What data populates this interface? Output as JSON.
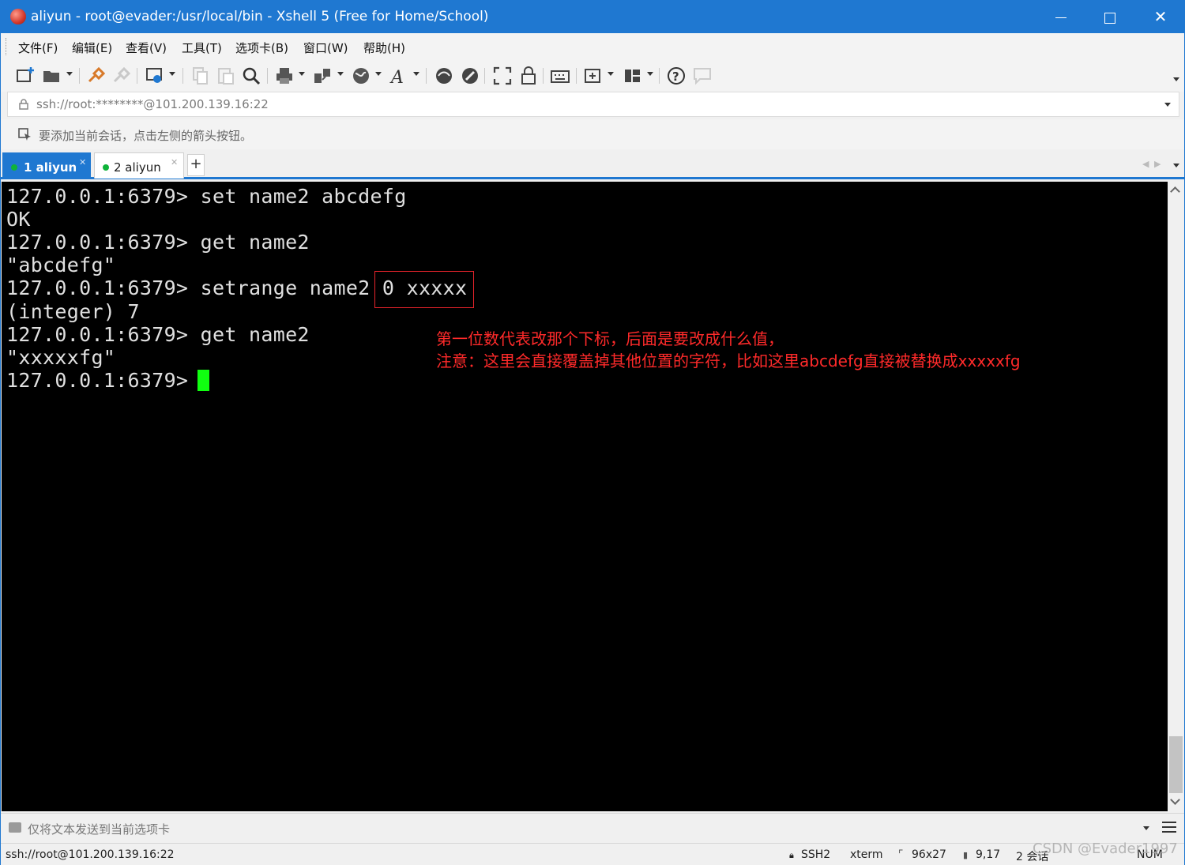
{
  "window": {
    "title": "aliyun - root@evader:/usr/local/bin - Xshell 5 (Free for Home/School)",
    "minimize_label": "minimize",
    "close_glyph": "✕"
  },
  "menu": [
    {
      "label": "文件(F)"
    },
    {
      "label": "编辑(E)"
    },
    {
      "label": "查看(V)"
    },
    {
      "label": "工具(T)"
    },
    {
      "label": "选项卡(B)"
    },
    {
      "label": "窗口(W)"
    },
    {
      "label": "帮助(H)"
    }
  ],
  "toolbar_icons": [
    "new-session-icon",
    "open-folder-icon",
    "reconnect-icon",
    "disconnect-icon",
    "properties-icon",
    "copy-icon",
    "paste-icon",
    "find-icon",
    "print-icon",
    "transfer-icon",
    "globe-icon",
    "font-icon",
    "xftp-icon",
    "xmanager-icon",
    "fullscreen-icon",
    "lock-icon",
    "keyboard-icon",
    "new-tab-icon",
    "layout-icon",
    "help-icon",
    "chat-icon"
  ],
  "address": {
    "text": "ssh://root:********@101.200.139.16:22"
  },
  "hint": {
    "text": "要添加当前会话，点击左侧的箭头按钮。"
  },
  "tabs": [
    {
      "label": "1 aliyun",
      "active": true
    },
    {
      "label": "2 aliyun",
      "active": false
    }
  ],
  "tab_add_label": "+",
  "terminal": {
    "lines": [
      "127.0.0.1:6379> set name2 abcdefg",
      "OK",
      "127.0.0.1:6379> get name2",
      "\"abcdefg\"",
      "127.0.0.1:6379> setrange name2 0 xxxxx",
      "(integer) 7",
      "127.0.0.1:6379> get name2",
      "\"xxxxxfg\"",
      "127.0.0.1:6379> "
    ],
    "annotation_line1": "第一位数代表改那个下标，后面是要改成什么值，",
    "annotation_line2": "注意：这里会直接覆盖掉其他位置的字符，比如这里abcdefg直接被替换成xxxxxfg",
    "cursor_color": "#10ff10",
    "annotation_color": "#ff2a2a"
  },
  "compose": {
    "text": "仅将文本发送到当前选项卡"
  },
  "status": {
    "connection": "ssh://root@101.200.139.16:22",
    "protocol": "SSH2",
    "terminal_type": "xterm",
    "size": "96x27",
    "cursor_pos": "9,17",
    "sessions": "2 会话",
    "num": "NUM"
  },
  "watermark": "CSDN @Evader1997",
  "colors": {
    "accent": "#1f78d1"
  }
}
